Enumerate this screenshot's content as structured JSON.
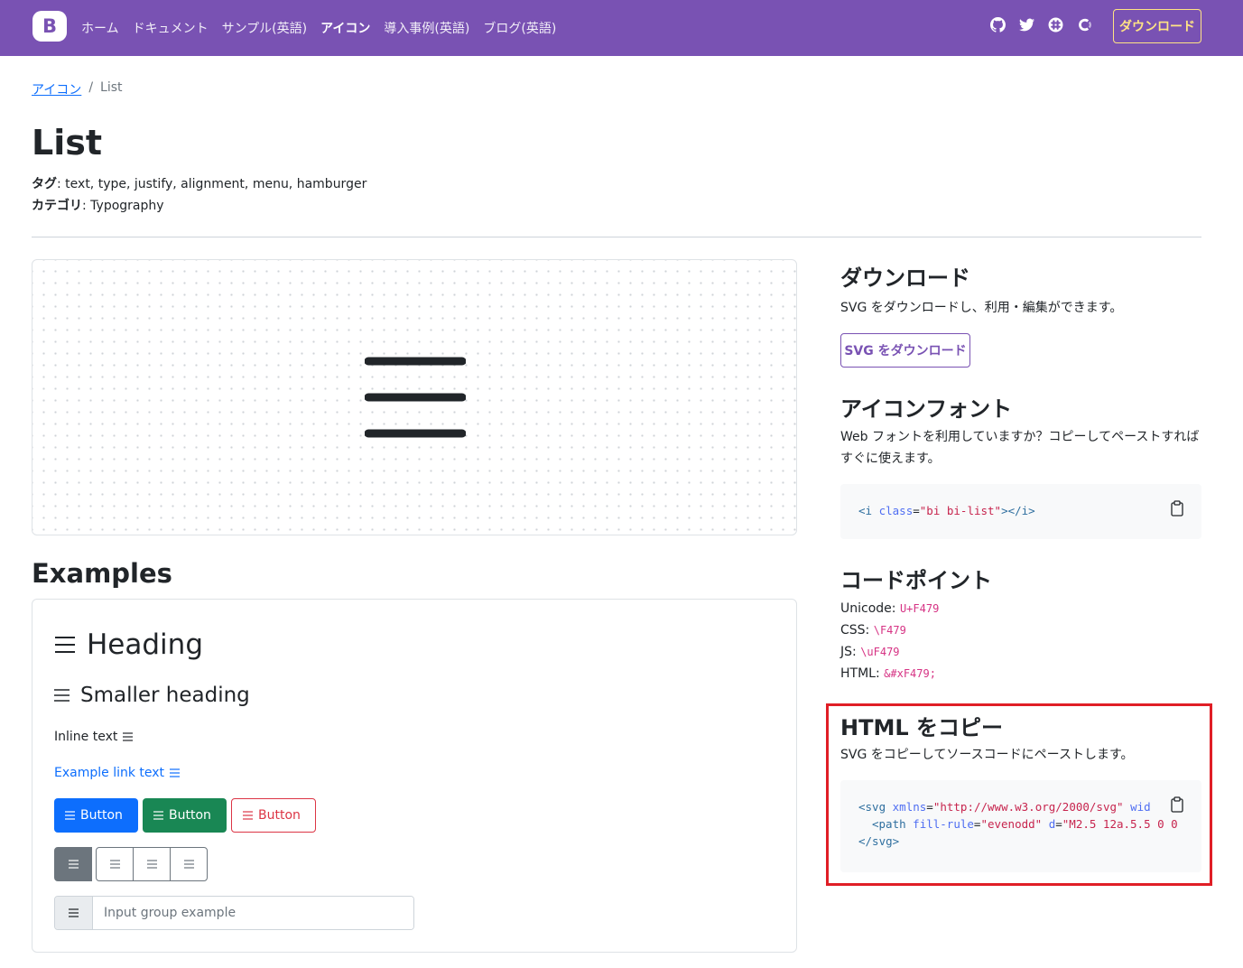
{
  "navbar": {
    "brand_letter": "B",
    "links": [
      "ホーム",
      "ドキュメント",
      "サンプル(英語)",
      "アイコン",
      "導入事例(英語)",
      "ブログ(英語)"
    ],
    "active_index": 3,
    "icons": [
      "github-icon",
      "twitter-icon",
      "slack-icon",
      "opencollective-icon"
    ],
    "download_label": "ダウンロード"
  },
  "breadcrumb": {
    "parent": "アイコン",
    "separator": "/",
    "current": "List"
  },
  "icon_page": {
    "title": "List",
    "tags_label": "タグ",
    "tags": "text, type, justify, alignment, menu, hamburger",
    "category_label": "カテゴリ",
    "category": "Typography"
  },
  "examples": {
    "title": "Examples",
    "heading": "Heading",
    "smaller_heading": "Smaller heading",
    "inline_text": "Inline text",
    "link_text": "Example link text",
    "button_label": "Button",
    "input_placeholder": "Input group example"
  },
  "download": {
    "title": "ダウンロード",
    "description": "SVG をダウンロードし、利用・編集ができます。",
    "button": "SVG をダウンロード"
  },
  "icon_font": {
    "title": "アイコンフォント",
    "description": "Web フォントを利用していますか？コピーしてペーストすればすぐに使えます。",
    "code_tag_open": "<i",
    "code_attr": "class",
    "code_value": "\"bi bi-list\"",
    "code_tag_close": "></i>"
  },
  "code_point": {
    "title": "コードポイント",
    "unicode_label": "Unicode:",
    "unicode": "U+F479",
    "css_label": "CSS:",
    "css": "\\F479",
    "js_label": "JS:",
    "js": "\\uF479",
    "html_label": "HTML:",
    "html": "&#xF479;"
  },
  "copy_html": {
    "title": "HTML をコピー",
    "description": "SVG をコピーしてソースコードにペーストします。",
    "line1_tag": "<svg",
    "line1_attr": "xmlns",
    "line1_value": "\"http://www.w3.org/2000/svg\"",
    "line1_trail": "wid",
    "line2_tag": "<path",
    "line2_attr1": "fill-rule",
    "line2_value1": "\"evenodd\"",
    "line2_attr2": "d",
    "line2_value2": "\"M2.5 12a.5.5 0 0",
    "line3": "</svg>"
  },
  "colors": {
    "brand": "#7952b3",
    "accent_yellow": "#ffe484",
    "primary": "#0d6efd",
    "success": "#198754",
    "danger": "#dc3545",
    "highlight": "#e01e26"
  }
}
